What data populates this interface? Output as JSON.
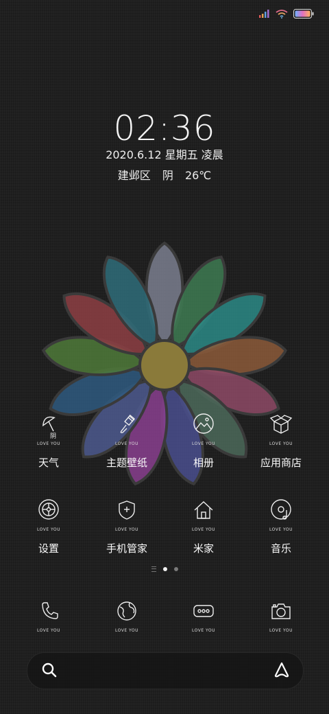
{
  "status_bar": {
    "signal": "signal-icon",
    "wifi": "wifi-icon",
    "battery": "battery-icon"
  },
  "lockscreen": {
    "time": "02:36",
    "date": "2020.6.12  星期五  凌晨",
    "location": "建邺区",
    "weather": "阴",
    "temperature": "26℃"
  },
  "apps_row1": [
    {
      "label": "天气",
      "icon": "umbrella-icon",
      "badge": "LOVE  YOU",
      "weather_note": "阴"
    },
    {
      "label": "主题壁纸",
      "icon": "paintbrush-icon",
      "badge": "LOVE  YOU"
    },
    {
      "label": "相册",
      "icon": "gallery-icon",
      "badge": "LOVE  YOU"
    },
    {
      "label": "应用商店",
      "icon": "box-icon",
      "badge": "LOVE  YOU"
    }
  ],
  "apps_row2": [
    {
      "label": "设置",
      "icon": "settings-wheel-icon",
      "badge": "LOVE  YOU"
    },
    {
      "label": "手机管家",
      "icon": "shield-icon",
      "badge": "LOVE  YOU"
    },
    {
      "label": "米家",
      "icon": "home-icon",
      "badge": "LOVE  YOU"
    },
    {
      "label": "音乐",
      "icon": "music-disc-icon",
      "badge": "LOVE  YOU"
    }
  ],
  "dock": [
    {
      "icon": "phone-icon",
      "badge": "LOVE  YOU"
    },
    {
      "icon": "browser-globe-icon",
      "badge": "LOVE  YOU"
    },
    {
      "icon": "message-icon",
      "badge": "LOVE  YOU"
    },
    {
      "icon": "camera-icon",
      "badge": "LOVE  YOU"
    }
  ],
  "pages": {
    "count": 2,
    "current": 1
  },
  "search": {
    "search_icon": "search-icon",
    "assistant_icon": "assistant-icon"
  },
  "colors": {
    "petals": [
      "#7b7f8f",
      "#3e7b52",
      "#2b8a86",
      "#8c5a3a",
      "#8e4a66",
      "#4c6a5a",
      "#4a4f8e",
      "#8a3f8f",
      "#4d5a8f",
      "#2f5a80",
      "#4f7a3a",
      "#8e3f44",
      "#2f6d7a"
    ],
    "center": "#8a7a3a"
  }
}
